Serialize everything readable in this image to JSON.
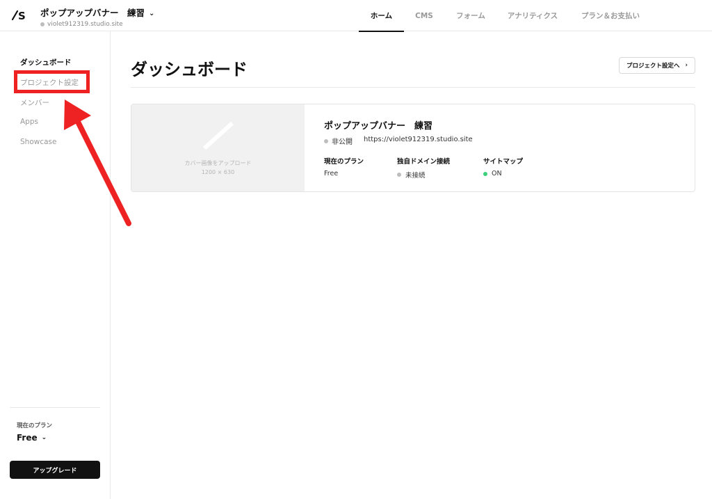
{
  "header": {
    "project_name": "ポップアップバナー　練習",
    "project_url": "violet912319.studio.site",
    "nav": [
      {
        "label": "ホーム",
        "active": true
      },
      {
        "label": "CMS",
        "active": false
      },
      {
        "label": "フォーム",
        "active": false
      },
      {
        "label": "アナリティクス",
        "active": false
      },
      {
        "label": "プラン＆お支払い",
        "active": false
      }
    ]
  },
  "sidebar": {
    "items": [
      {
        "label": "ダッシュボード",
        "active": true
      },
      {
        "label": "プロジェクト設定",
        "active": false,
        "highlighted": true
      },
      {
        "label": "メンバー",
        "active": false
      },
      {
        "label": "Apps",
        "active": false
      },
      {
        "label": "Showcase",
        "active": false
      }
    ],
    "plan_label": "現在のプラン",
    "plan_value": "Free",
    "upgrade_label": "アップグレード"
  },
  "main": {
    "title": "ダッシュボード",
    "settings_button": "プロジェクト設定へ",
    "card": {
      "cover_label": "カバー画像をアップロード",
      "cover_size": "1200 × 630",
      "title": "ポップアップバナー　練習",
      "status": "非公開",
      "url": "https://violet912319.studio.site",
      "meta": [
        {
          "label": "現在のプラン",
          "value": "Free",
          "dot": "none"
        },
        {
          "label": "独自ドメイン接続",
          "value": "未接続",
          "dot": "gray"
        },
        {
          "label": "サイトマップ",
          "value": "ON",
          "dot": "green"
        }
      ]
    }
  },
  "colors": {
    "accent": "#111111",
    "highlight": "#ee2222",
    "status_on": "#3ccf7a",
    "status_off": "#bdbdbd"
  }
}
